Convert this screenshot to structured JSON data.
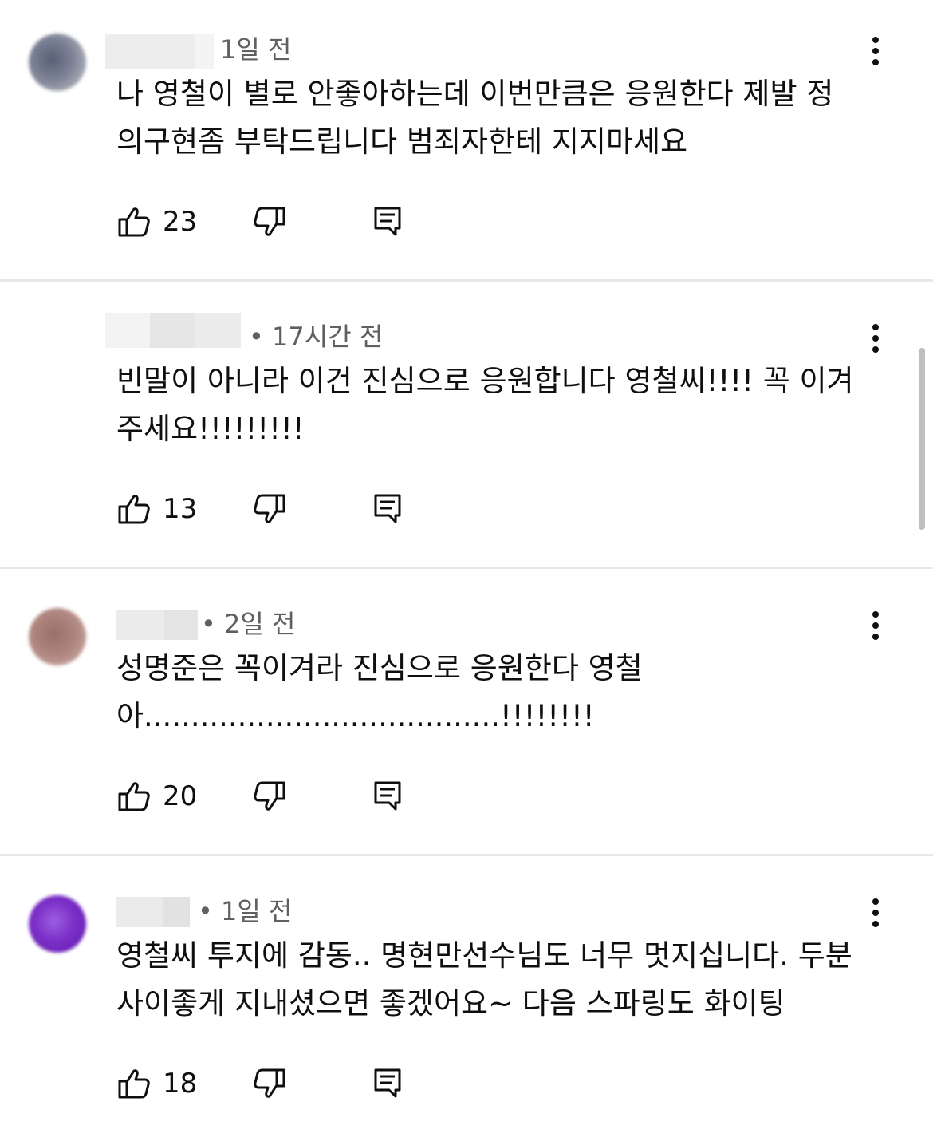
{
  "comments": [
    {
      "time": "1일 전",
      "text": "나 영철이 별로 안좋아하는데 이번만큼은 응원한다 제발 정\n의구현좀 부탁드립니다 범죄자한테 지지마세요",
      "likes": "23",
      "avatar_color": "#7d8396"
    },
    {
      "time": "• 17시간 전",
      "text": "빈말이 아니라 이건 진심으로 응원합니다 영철씨!!!! 꼭 이겨\n주세요!!!!!!!!!",
      "likes": "13"
    },
    {
      "time": "• 2일 전",
      "text": "성명준은 꼭이겨라 진심으로 응원한다 영철\n아......................................!!!!!!!!",
      "likes": "20",
      "avatar_color": "#b08780"
    },
    {
      "time": "• 1일 전",
      "text": "영철씨 투지에 감동.. 명현만선수님도 너무 멋지십니다. 두분\n사이좋게 지내셨으면 좋겠어요~ 다음 스파링도 화이팅",
      "likes": "18",
      "avatar_color": "#7b2fc7"
    }
  ],
  "icons": {
    "like": "thumbs-up-icon",
    "dislike": "thumbs-down-icon",
    "reply": "reply-icon",
    "more": "more-vertical-icon"
  }
}
